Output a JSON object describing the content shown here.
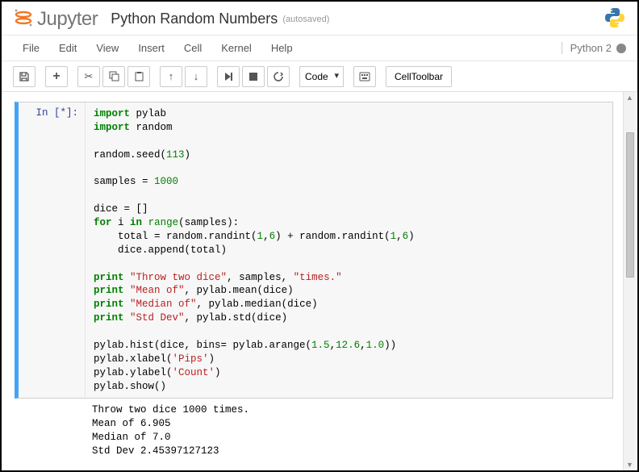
{
  "header": {
    "logo_text": "Jupyter",
    "title": "Python Random Numbers",
    "autosaved": "(autosaved)"
  },
  "menu": {
    "file": "File",
    "edit": "Edit",
    "view": "View",
    "insert": "Insert",
    "cell": "Cell",
    "kernel": "Kernel",
    "help": "Help"
  },
  "kernel": {
    "name": "Python 2"
  },
  "toolbar": {
    "celltype_options": [
      "Code"
    ],
    "celltype_selected": "Code",
    "celltoolbar_label": "CellToolbar"
  },
  "cell": {
    "prompt": "In [*]:",
    "code": {
      "l1a": "import",
      "l1b": " pylab",
      "l2a": "import",
      "l2b": " random",
      "l3": "",
      "l4a": "random.seed(",
      "l4n": "113",
      "l4b": ")",
      "l5": "",
      "l6a": "samples = ",
      "l6n": "1000",
      "l7": "",
      "l8": "dice = []",
      "l9a": "for",
      "l9b": " i ",
      "l9c": "in",
      "l9d": " ",
      "l9e": "range",
      "l9f": "(samples):",
      "l10a": "    total = random.randint(",
      "l10n1": "1",
      "l10c1": ",",
      "l10n2": "6",
      "l10b": ") + random.randint(",
      "l10n3": "1",
      "l10c2": ",",
      "l10n4": "6",
      "l10d": ")",
      "l11": "    dice.append(total)",
      "l12": "",
      "l13a": "print",
      "l13b": " ",
      "l13s1": "\"Throw two dice\"",
      "l13c": ", samples, ",
      "l13s2": "\"times.\"",
      "l14a": "print",
      "l14b": " ",
      "l14s": "\"Mean of\"",
      "l14c": ", pylab.mean(dice)",
      "l15a": "print",
      "l15b": " ",
      "l15s": "\"Median of\"",
      "l15c": ", pylab.median(dice)",
      "l16a": "print",
      "l16b": " ",
      "l16s": "\"Std Dev\"",
      "l16c": ", pylab.std(dice)",
      "l17": "",
      "l18a": "pylab.hist(dice, bins= pylab.arange(",
      "l18n1": "1.5",
      "l18c1": ",",
      "l18n2": "12.6",
      "l18c2": ",",
      "l18n3": "1.0",
      "l18b": "))",
      "l19a": "pylab.xlabel(",
      "l19s": "'Pips'",
      "l19b": ")",
      "l20a": "pylab.ylabel(",
      "l20s": "'Count'",
      "l20b": ")",
      "l21": "pylab.show()"
    },
    "output": {
      "l1": "Throw two dice 1000 times.",
      "l2": "Mean of 6.905",
      "l3": "Median of 7.0",
      "l4": "Std Dev 2.45397127123"
    }
  }
}
